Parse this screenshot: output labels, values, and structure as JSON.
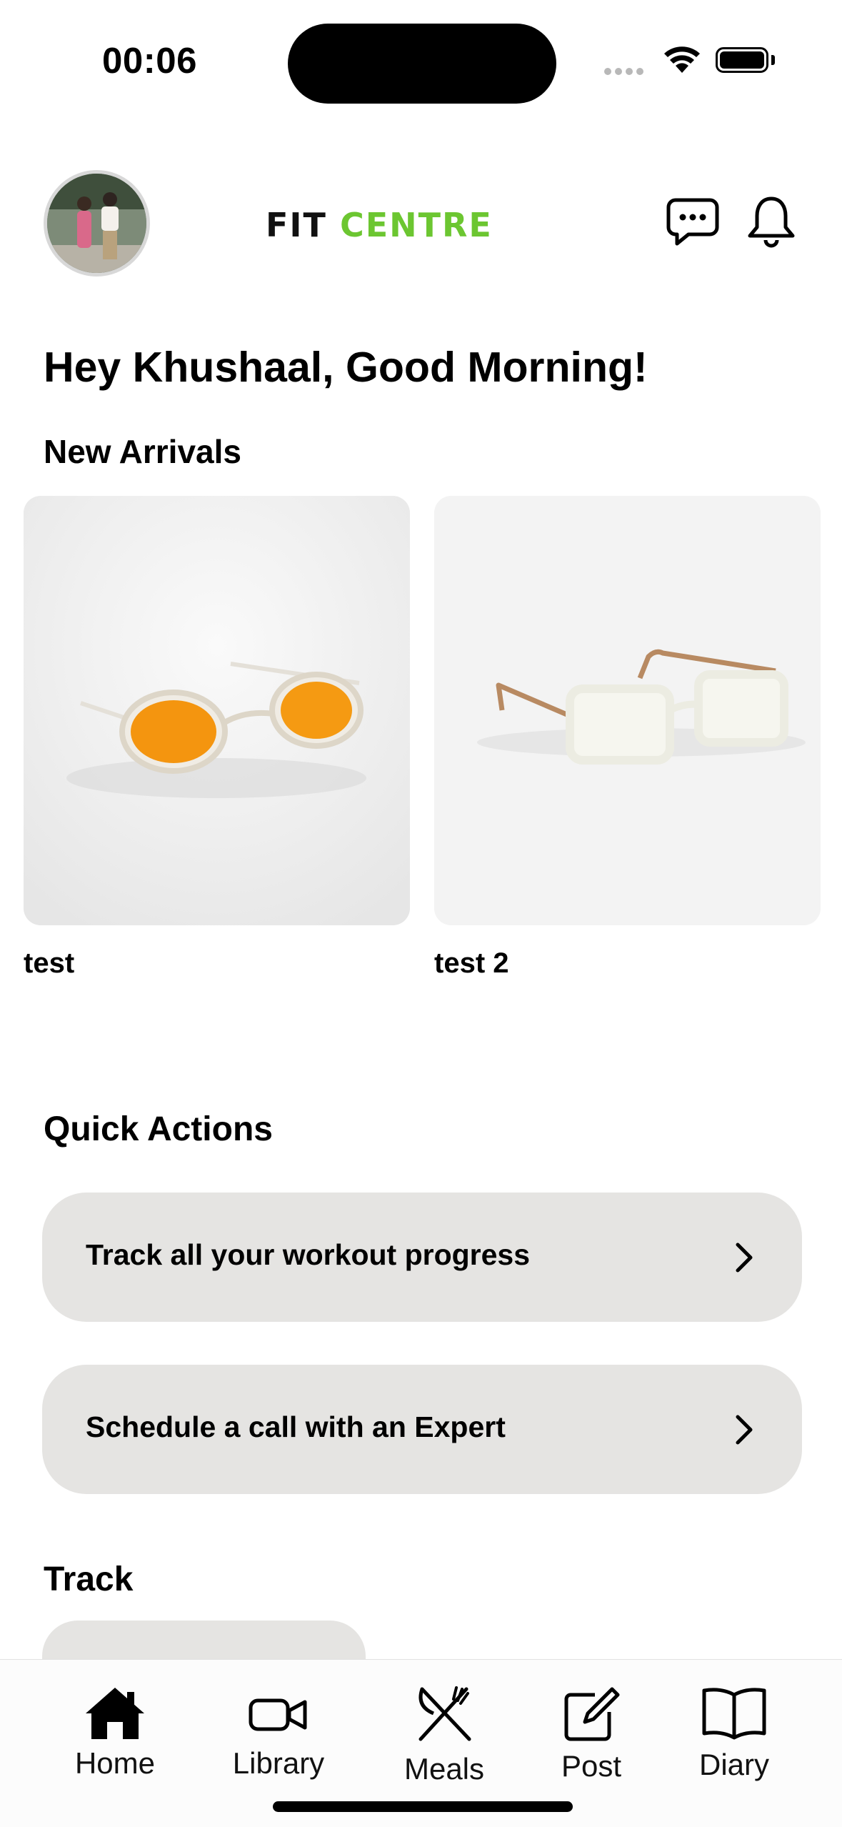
{
  "status_bar": {
    "time": "00:06"
  },
  "header": {
    "brand_part1": "FIT",
    "brand_part2": "CENTRE",
    "brand_colors": {
      "dark": "#111111",
      "accent": "#6cc631"
    },
    "icons": [
      "chat-bubble-icon",
      "bell-icon"
    ]
  },
  "greeting": "Hey Khushaal, Good Morning!",
  "new_arrivals": {
    "title": "New Arrivals",
    "items": [
      {
        "label": "test",
        "image": "orange-tinted-sunglasses"
      },
      {
        "label": "test 2",
        "image": "clear-frame-eyeglasses"
      }
    ]
  },
  "quick_actions": {
    "title": "Quick Actions",
    "items": [
      {
        "label": "Track all your workout progress",
        "icon": "chevron-right-icon"
      },
      {
        "label": "Schedule a call with an Expert",
        "icon": "chevron-right-icon"
      }
    ]
  },
  "track": {
    "title": "Track"
  },
  "tab_bar": {
    "tabs": [
      {
        "label": "Home",
        "icon": "house-icon",
        "selected": true
      },
      {
        "label": "Library",
        "icon": "video-camera-icon"
      },
      {
        "label": "Meals",
        "icon": "fork-knife-icon"
      },
      {
        "label": "Post",
        "icon": "compose-icon"
      },
      {
        "label": "Diary",
        "icon": "book-icon"
      }
    ]
  }
}
